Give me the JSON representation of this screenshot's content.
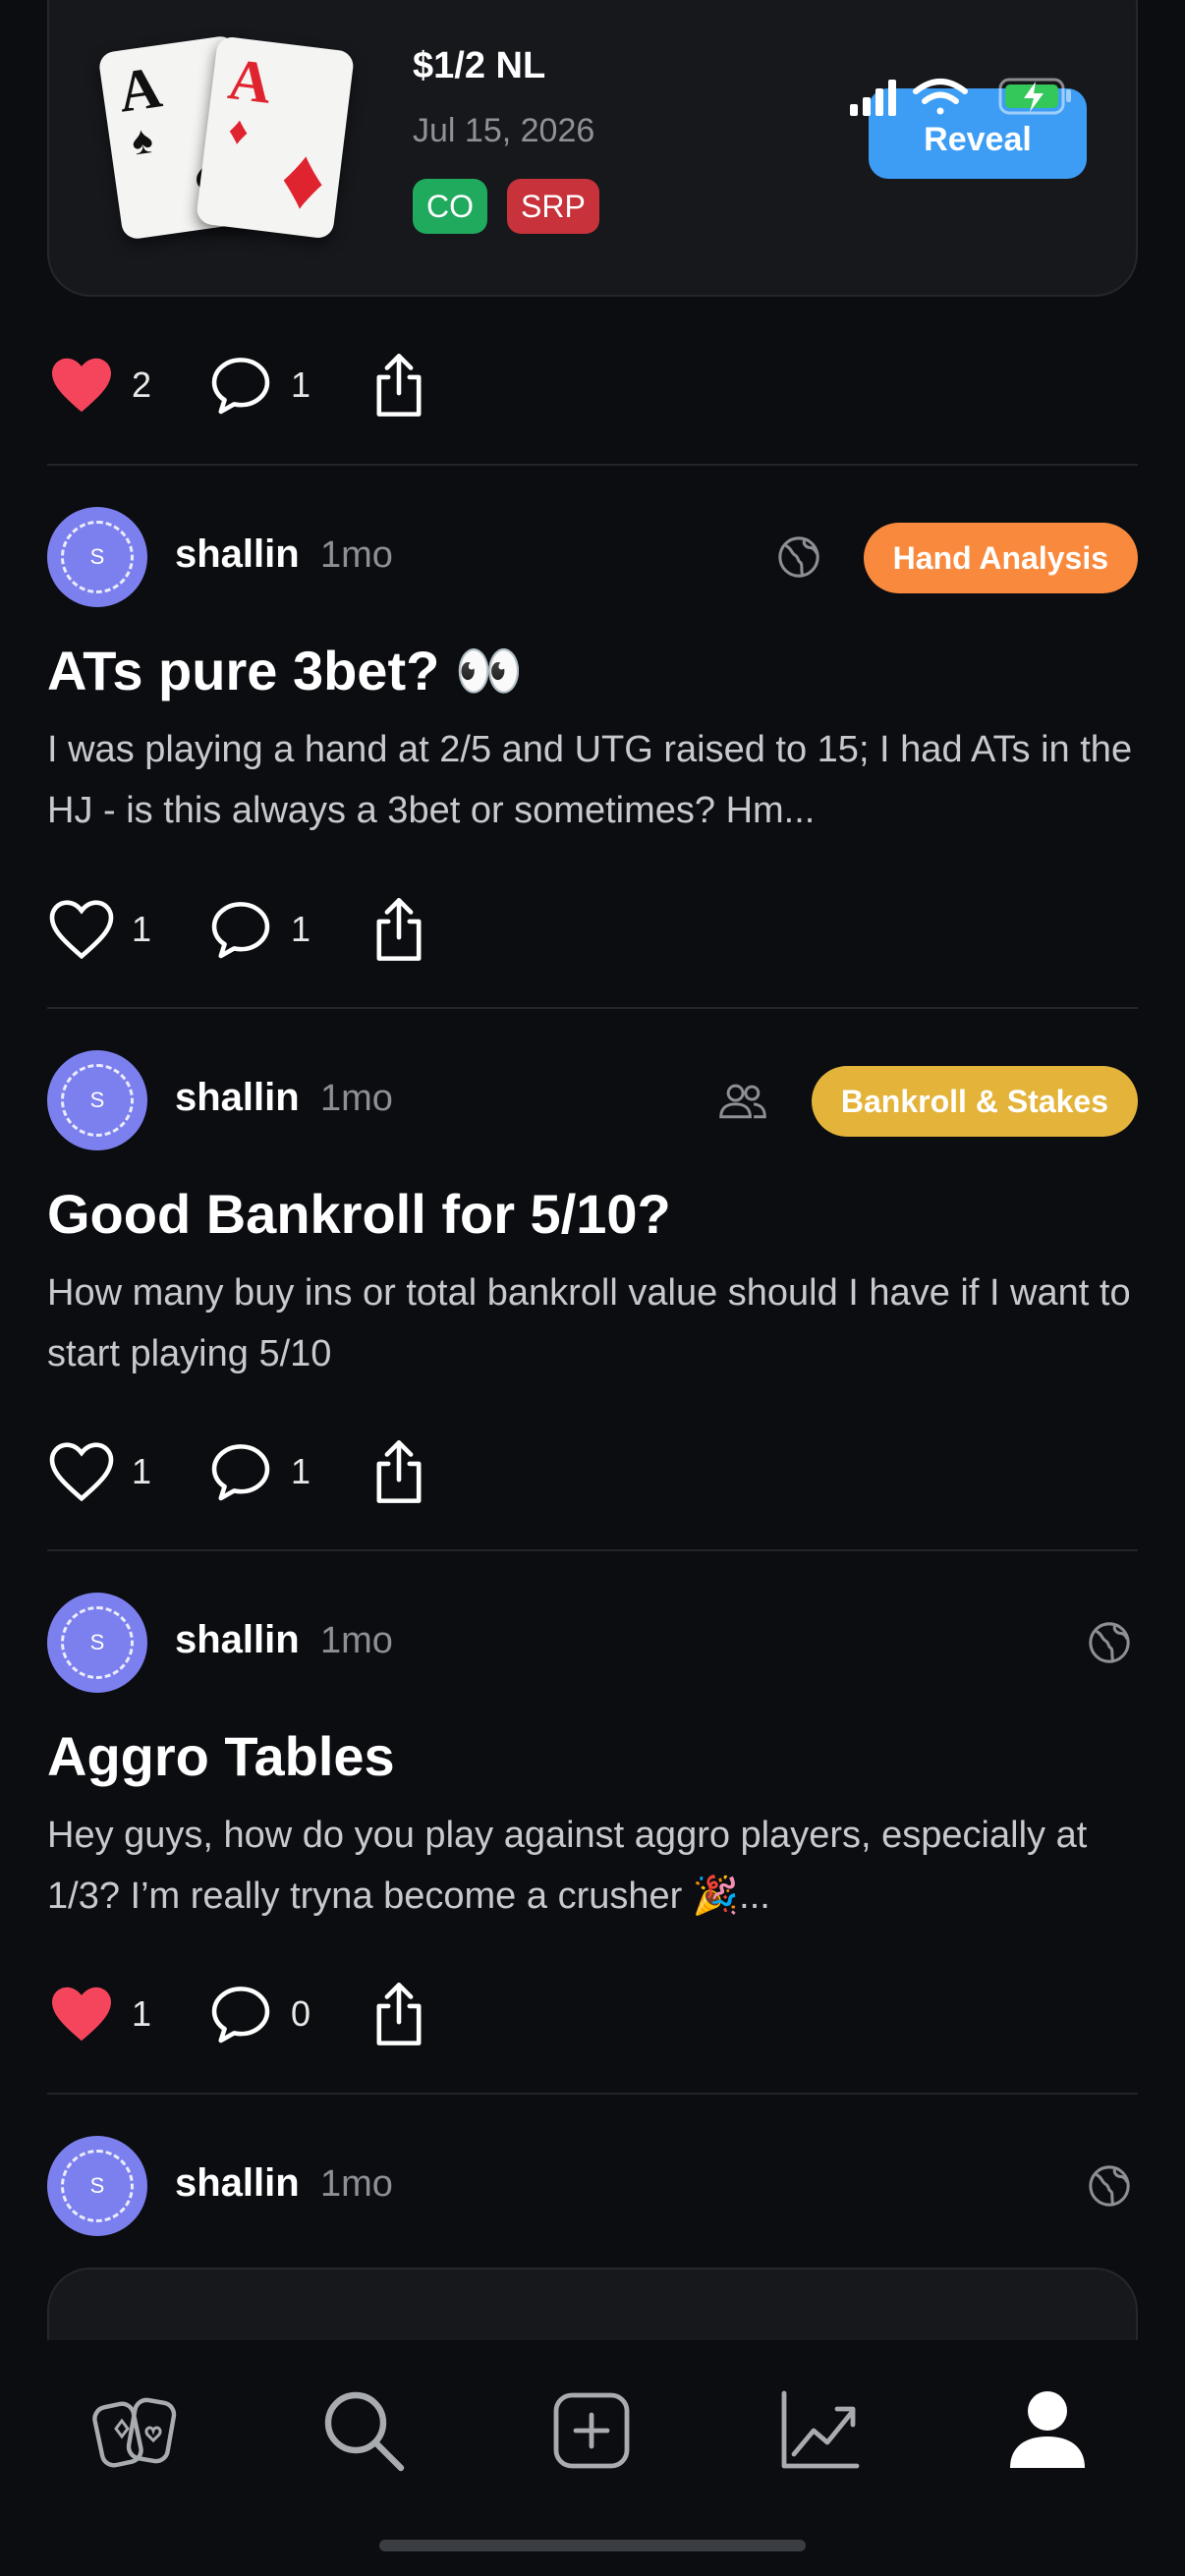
{
  "hand": {
    "cards": [
      {
        "rank": "A",
        "suit": "♠"
      },
      {
        "rank": "A",
        "suit": "♦"
      }
    ],
    "stakes": "$1/2 NL",
    "date": "Jul 15, 2026",
    "position_badge": "CO",
    "pot_type_badge": "SRP",
    "reveal_label": "Reveal"
  },
  "top_actions": {
    "likes": "2",
    "comments": "1",
    "liked": true
  },
  "posts": [
    {
      "username": "shallin",
      "avatar_letter": "S",
      "time": "1mo",
      "visibility": "globe-icon",
      "category": "Hand Analysis",
      "category_color": "#f98a3d",
      "title": "ATs pure 3bet? 👀",
      "body": "I was playing a hand at 2/5 and UTG raised to 15; I had ATs in the HJ - is this always a 3bet or sometimes?  Hm...",
      "likes": "1",
      "comments": "1",
      "liked": false
    },
    {
      "username": "shallin",
      "avatar_letter": "S",
      "time": "1mo",
      "visibility": "friends-icon",
      "category": "Bankroll & Stakes",
      "category_color": "#e4b43a",
      "title": "Good Bankroll for 5/10?",
      "body": "How many buy ins or total bankroll value should I have if I want to start playing 5/10",
      "likes": "1",
      "comments": "1",
      "liked": false
    },
    {
      "username": "shallin",
      "avatar_letter": "S",
      "time": "1mo",
      "visibility": "globe-icon",
      "title": "Aggro Tables",
      "body": "Hey guys, how do you play against aggro players, especially at 1/3? I’m really tryna become a crusher 🎉...",
      "likes": "1",
      "comments": "0",
      "liked": true
    },
    {
      "username": "shallin",
      "avatar_letter": "S",
      "time": "1mo",
      "visibility": "globe-icon"
    }
  ],
  "tab_bar": [
    "cards-icon",
    "search-icon",
    "add-post-icon",
    "stats-chart-icon",
    "profile-icon"
  ],
  "colors": {
    "background": "#0b0d10",
    "accent": "#3d9df5",
    "like": "#f5455c"
  }
}
